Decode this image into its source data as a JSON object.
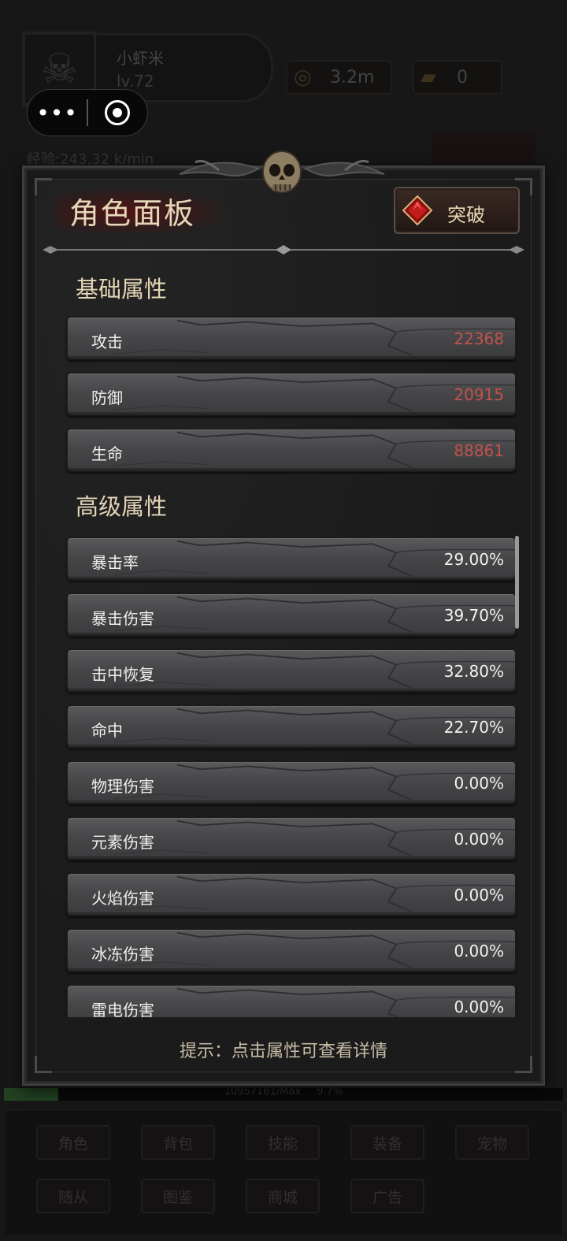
{
  "player": {
    "name": "小虾米",
    "level": "lv.72",
    "exp_rate": "经验:243.32 k/min"
  },
  "resources": {
    "gold": "3.2m",
    "ingot": "0"
  },
  "panel": {
    "title": "角色面板",
    "break_button": "突破",
    "basic_section": "基础属性",
    "advanced_section": "高级属性",
    "hint": "提示：点击属性可查看详情",
    "basic_stats": [
      {
        "label": "攻击",
        "value": "22368"
      },
      {
        "label": "防御",
        "value": "20915"
      },
      {
        "label": "生命",
        "value": "88861"
      }
    ],
    "advanced_stats": [
      {
        "label": "暴击率",
        "value": "29.00%"
      },
      {
        "label": "暴击伤害",
        "value": "39.70%"
      },
      {
        "label": "击中恢复",
        "value": "32.80%"
      },
      {
        "label": "命中",
        "value": "22.70%"
      },
      {
        "label": "物理伤害",
        "value": "0.00%"
      },
      {
        "label": "元素伤害",
        "value": "0.00%"
      },
      {
        "label": "火焰伤害",
        "value": "0.00%"
      },
      {
        "label": "冰冻伤害",
        "value": "0.00%"
      },
      {
        "label": "雷电伤害",
        "value": "0.00%"
      }
    ]
  },
  "progress": {
    "text": "10957161/Max",
    "percent_text": "9.7%",
    "fraction": 0.097
  },
  "nav": [
    {
      "label": "角色"
    },
    {
      "label": "背包"
    },
    {
      "label": "技能"
    },
    {
      "label": "装备"
    },
    {
      "label": "宠物"
    },
    {
      "label": "随从"
    },
    {
      "label": "图鉴"
    },
    {
      "label": "商城"
    },
    {
      "label": "广告"
    }
  ],
  "icons": {
    "avatar": "skull-gear-icon",
    "gold": "coins-icon",
    "ingot": "gold-bars-icon",
    "break": "red-gem-icon",
    "capsule_more": "more-dots-icon",
    "capsule_close": "close-target-icon"
  },
  "colors": {
    "value_red": "#c2524a",
    "title_gold": "#e6d6b8",
    "progress_green": "#3c7a3c"
  }
}
